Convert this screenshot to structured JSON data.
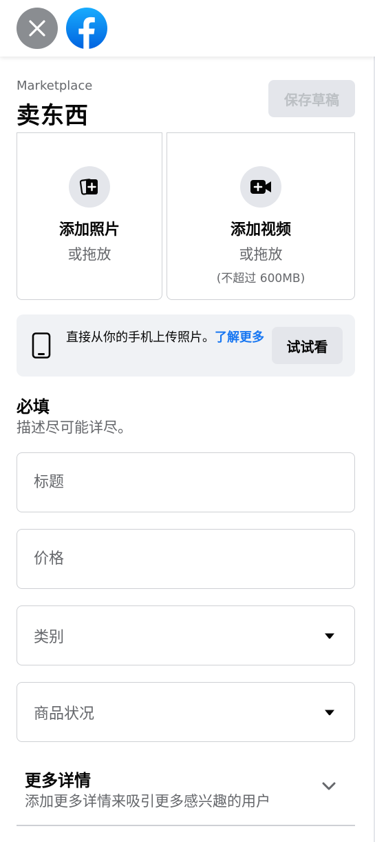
{
  "header": {
    "eyebrow": "Marketplace",
    "title": "卖东西",
    "save_draft": "保存草稿"
  },
  "media": {
    "photo": {
      "title": "添加照片",
      "sub": "或拖放"
    },
    "video": {
      "title": "添加视频",
      "sub": "或拖放",
      "note": "(不超过 600MB)"
    }
  },
  "mobile_banner": {
    "text": "直接从你的手机上传照片。",
    "link": "了解更多",
    "button": "试试看"
  },
  "required": {
    "title": "必填",
    "subtitle": "描述尽可能详尽。"
  },
  "fields": {
    "title_placeholder": "标题",
    "price_placeholder": "价格",
    "category_label": "类别",
    "condition_label": "商品状况"
  },
  "more_details": {
    "title": "更多详情",
    "subtitle": "添加更多详情来吸引更多感兴趣的用户"
  },
  "colors": {
    "accent": "#1877f2",
    "muted": "#65676b",
    "surface": "#f0f2f5",
    "button": "#e4e6eb"
  }
}
